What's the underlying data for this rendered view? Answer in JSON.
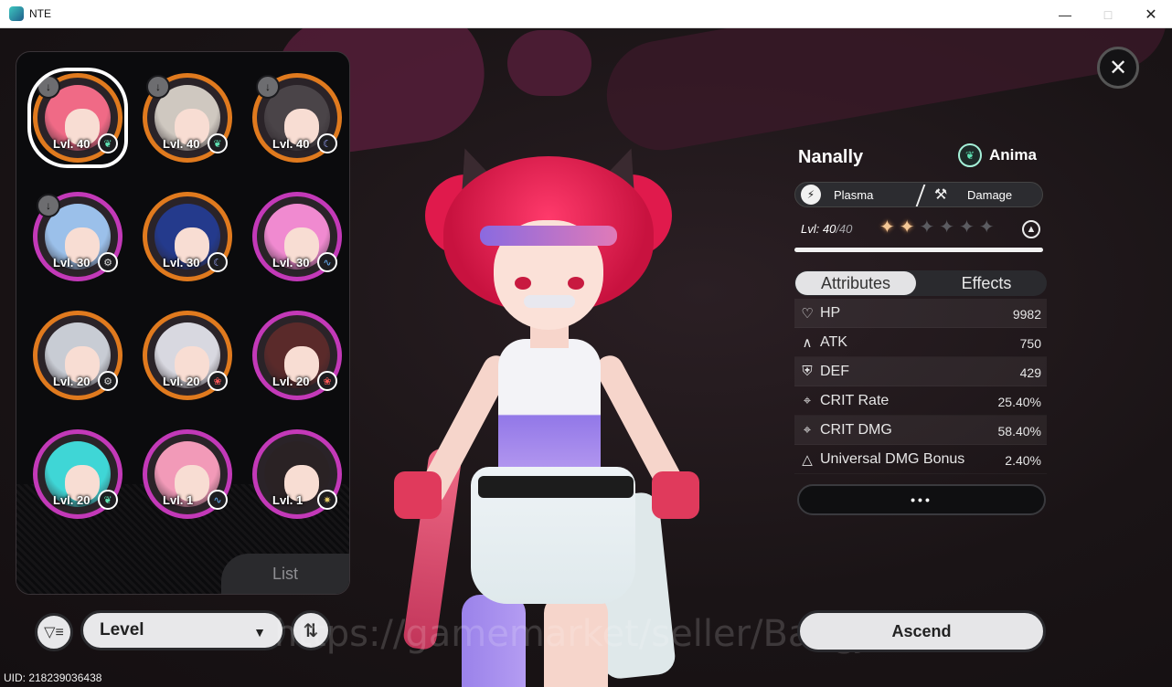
{
  "window": {
    "title": "NTE",
    "min_icon": "minimize-icon",
    "max_icon": "maximize-icon",
    "close_icon": "close-icon"
  },
  "roster": {
    "list_tab": "List",
    "characters": [
      {
        "level": "Lvl. 40",
        "element": "anima",
        "border": "orange",
        "downloaded": true,
        "selected": true,
        "hair": "#f06a86"
      },
      {
        "level": "Lvl. 40",
        "element": "anima",
        "border": "orange",
        "downloaded": true,
        "selected": false,
        "hair": "#cfc8c0"
      },
      {
        "level": "Lvl. 40",
        "element": "lunar",
        "border": "orange",
        "downloaded": true,
        "selected": false,
        "hair": "#4a4448"
      },
      {
        "level": "Lvl. 30",
        "element": "gear",
        "border": "purple",
        "downloaded": true,
        "selected": false,
        "hair": "#9bc0ea"
      },
      {
        "level": "Lvl. 30",
        "element": "lunar",
        "border": "orange",
        "downloaded": false,
        "selected": false,
        "hair": "#243a8c"
      },
      {
        "level": "Lvl. 30",
        "element": "wave",
        "border": "purple",
        "downloaded": false,
        "selected": false,
        "hair": "#f08ad0"
      },
      {
        "level": "Lvl. 20",
        "element": "gear",
        "border": "orange",
        "downloaded": false,
        "selected": false,
        "hair": "#c8ccd4"
      },
      {
        "level": "Lvl. 20",
        "element": "flame",
        "border": "orange",
        "downloaded": false,
        "selected": false,
        "hair": "#d8d8e0"
      },
      {
        "level": "Lvl. 20",
        "element": "flame",
        "border": "purple",
        "downloaded": false,
        "selected": false,
        "hair": "#5a2a2a"
      },
      {
        "level": "Lvl. 20",
        "element": "anima",
        "border": "purple",
        "downloaded": false,
        "selected": false,
        "hair": "#3fd6d6"
      },
      {
        "level": "Lvl. 1",
        "element": "wave",
        "border": "purple",
        "downloaded": false,
        "selected": false,
        "hair": "#f29ab8"
      },
      {
        "level": "Lvl. 1",
        "element": "spark",
        "border": "purple",
        "downloaded": false,
        "selected": false,
        "hair": "#2a2224"
      }
    ]
  },
  "controls": {
    "filter_icon": "filter-icon",
    "sort_label": "Level",
    "sort_icon": "sort-order-icon",
    "uid": "UID: 218239036438"
  },
  "character": {
    "name": "Nanally",
    "element_label": "Anima",
    "type_label": "Plasma",
    "role_label": "Damage",
    "level": "Lvl: 40",
    "level_max": "/40",
    "level_progress": 1.0,
    "stars_total": 6,
    "stars_filled": 2
  },
  "tabs": {
    "attributes": "Attributes",
    "effects": "Effects"
  },
  "stats": [
    {
      "icon": "heart-icon",
      "name": "HP",
      "value": "9982"
    },
    {
      "icon": "attack-icon",
      "name": "ATK",
      "value": "750"
    },
    {
      "icon": "shield-icon",
      "name": "DEF",
      "value": "429"
    },
    {
      "icon": "crit-icon",
      "name": "CRIT Rate",
      "value": "25.40%"
    },
    {
      "icon": "crit-icon",
      "name": "CRIT DMG",
      "value": "58.40%"
    },
    {
      "icon": "triangle-icon",
      "name": "Universal DMG Bonus",
      "value": "2.40%"
    }
  ],
  "more_label": "•••",
  "ascend_label": "Ascend",
  "watermark": "https://gamemarket/seller/BangJohn",
  "colors": {
    "orange_border": "#e07a1e",
    "purple_border": "#c339b8",
    "accent_pink": "#e01a4c"
  }
}
